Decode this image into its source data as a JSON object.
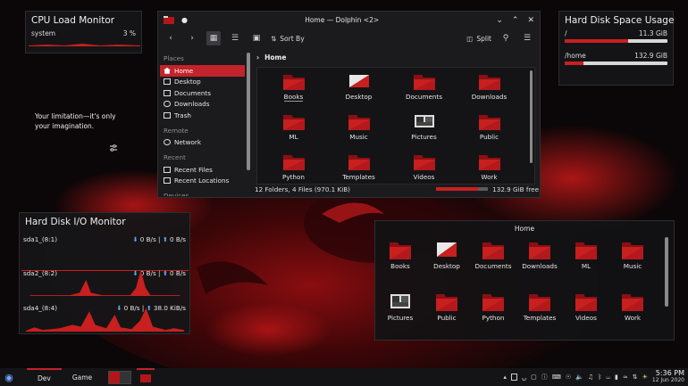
{
  "cpu_widget": {
    "title": "CPU Load Monitor",
    "label": "system",
    "value": "3 %"
  },
  "disk_space_widget": {
    "title": "Hard Disk Space Usage",
    "rows": [
      {
        "label": "/",
        "value": "11.3 GiB",
        "fill": 0.62
      },
      {
        "label": "/home",
        "value": "132.9 GiB",
        "fill": 0.18
      }
    ]
  },
  "quote": {
    "line1": "Your limitation—it's only",
    "line2": "your imagination."
  },
  "io_widget": {
    "title": "Hard Disk I/O Monitor",
    "disks": [
      {
        "name": "sda1_(8:1)",
        "read": "0 B/s",
        "write": "0 B/s"
      },
      {
        "name": "sda2_(8:2)",
        "read": "0 B/s",
        "write": "0 B/s"
      },
      {
        "name": "sda4_(8:4)",
        "read": "0 B/s",
        "write": "38.0 KiB/s"
      }
    ]
  },
  "dolphin": {
    "window_title": "Home — Dolphin <2>",
    "toolbar": {
      "sort_label": "Sort By",
      "split_label": "Split"
    },
    "places": {
      "header": "Places",
      "items": [
        "Home",
        "Desktop",
        "Documents",
        "Downloads",
        "Trash"
      ],
      "remote_header": "Remote",
      "remote_items": [
        "Network"
      ],
      "recent_header": "Recent",
      "recent_items": [
        "Recent Files",
        "Recent Locations"
      ],
      "devices_header": "Devices"
    },
    "breadcrumb": "Home",
    "folders": [
      "Books",
      "Desktop",
      "Documents",
      "Downloads",
      "ML",
      "Music",
      "Pictures",
      "Public",
      "Python",
      "Templates",
      "Videos",
      "Work"
    ],
    "status": "12 Folders, 4 Files (970.1 KiB)",
    "free_space": "132.9 GiB free",
    "used_fraction": 0.8
  },
  "folder_view": {
    "title": "Home",
    "folders": [
      "Books",
      "Desktop",
      "Documents",
      "Downloads",
      "ML",
      "Music",
      "Pictures",
      "Public",
      "Python",
      "Templates",
      "Videos",
      "Work"
    ]
  },
  "taskbar": {
    "tabs": [
      "Dev",
      "Game"
    ],
    "time": "5:36 PM",
    "date": "12 Jun 2020"
  },
  "colors": {
    "accent": "#c3232a",
    "bar": "#c81f1f"
  }
}
